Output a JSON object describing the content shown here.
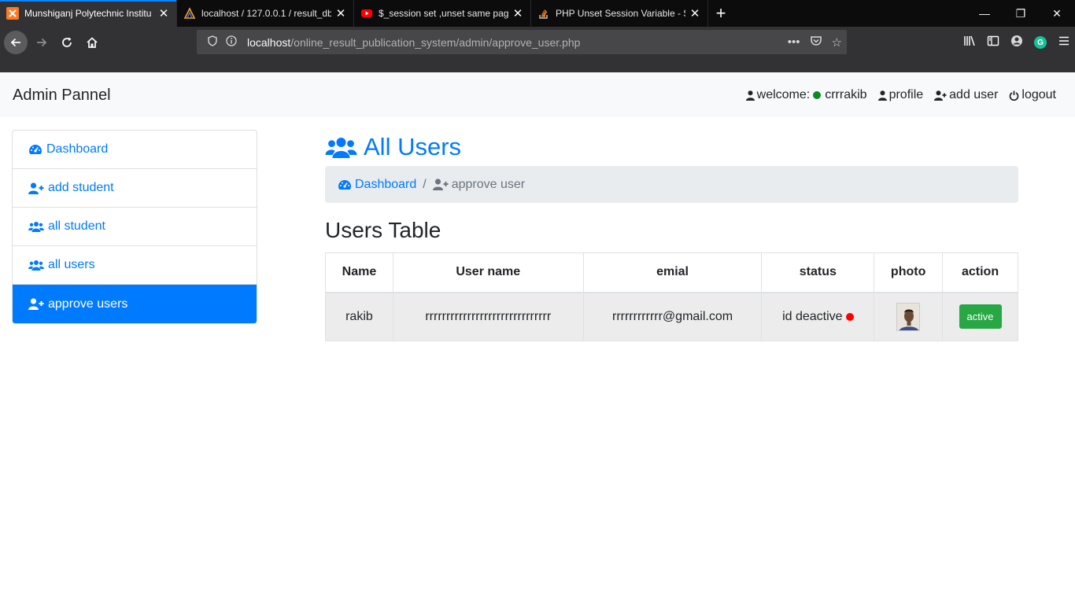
{
  "browser": {
    "tabs": [
      {
        "title": "Munshiganj Polytechnic Institu",
        "active": true,
        "icon": "xampp-icon"
      },
      {
        "title": "localhost / 127.0.0.1 / result_db",
        "active": false,
        "icon": "phpmyadmin-icon"
      },
      {
        "title": "$_session set ,unset same page",
        "active": false,
        "icon": "youtube-icon"
      },
      {
        "title": "PHP Unset Session Variable - St",
        "active": false,
        "icon": "stackoverflow-icon"
      }
    ],
    "url_host": "localhost",
    "url_path": "/online_result_publication_system/admin/approve_user.php"
  },
  "header": {
    "brand": "Admin Pannel",
    "welcome_label": "welcome:",
    "username": "crrrakib",
    "profile_label": "profile",
    "add_user_label": "add user",
    "logout_label": "logout"
  },
  "sidebar": {
    "items": [
      {
        "label": "Dashboard",
        "icon": "dashboard-icon",
        "active": false
      },
      {
        "label": "add student",
        "icon": "user-plus-icon",
        "active": false
      },
      {
        "label": "all student",
        "icon": "users-icon",
        "active": false
      },
      {
        "label": "all users",
        "icon": "users-icon",
        "active": false
      },
      {
        "label": "approve users",
        "icon": "user-plus-icon",
        "active": true
      }
    ]
  },
  "main": {
    "title": "All Users",
    "breadcrumb": {
      "link": "Dashboard",
      "separator": "/",
      "current": "approve user"
    },
    "table_title": "Users Table",
    "columns": [
      "Name",
      "User name",
      "emial",
      "status",
      "photo",
      "action"
    ],
    "rows": [
      {
        "name": "rakib",
        "username": "rrrrrrrrrrrrrrrrrrrrrrrrrrrrrr",
        "email": "rrrrrrrrrrrr@gmail.com",
        "status": "id deactive",
        "action": "active"
      }
    ]
  },
  "colors": {
    "primary": "#007bff",
    "success": "#28a745",
    "danger": "#ff0000",
    "online": "#0a8a1f"
  }
}
